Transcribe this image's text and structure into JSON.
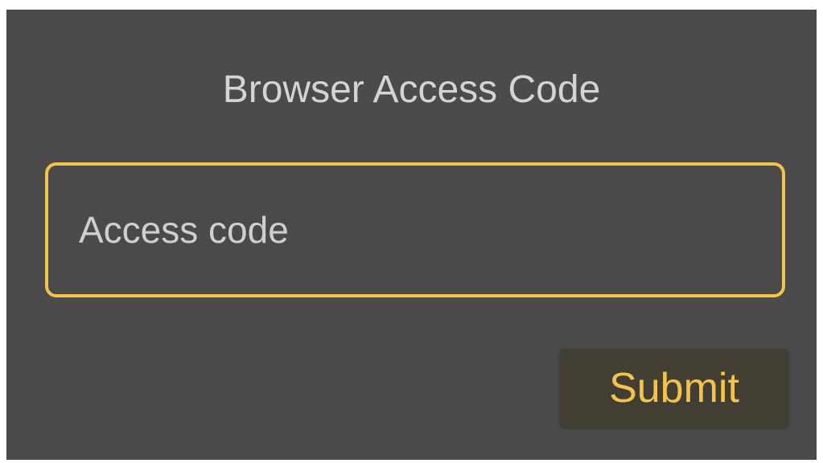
{
  "dialog": {
    "title": "Browser Access Code",
    "access_code_input": {
      "value": "",
      "placeholder": "Access code"
    },
    "submit_label": "Submit"
  },
  "colors": {
    "background": "#4b4b4b",
    "accent": "#f2c44a",
    "title_text": "#d4d4d4",
    "button_background": "#423e34"
  }
}
